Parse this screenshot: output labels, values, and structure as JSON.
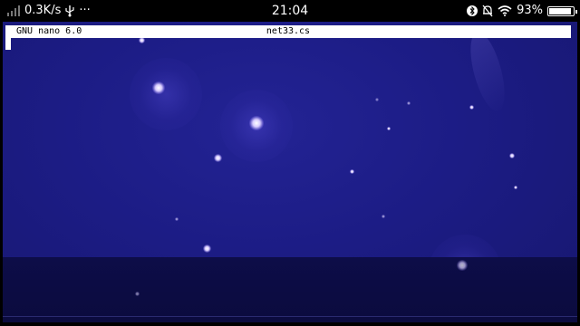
{
  "status_bar": {
    "network_speed": "0.3K/s",
    "more": "···",
    "time": "21:04",
    "battery_percent": "93%",
    "battery_level": 0.93,
    "icons": [
      "signal-icon",
      "usb-icon",
      "bluetooth-icon",
      "alarm-off-icon",
      "wifi-icon",
      "battery-icon"
    ]
  },
  "nano": {
    "version": "GNU nano 6.0",
    "filename": "net33.cs"
  },
  "colors": {
    "background": "#1c1c85",
    "header_bg": "#ffffff",
    "header_fg": "#000000",
    "statusbar_bg": "#000000"
  }
}
